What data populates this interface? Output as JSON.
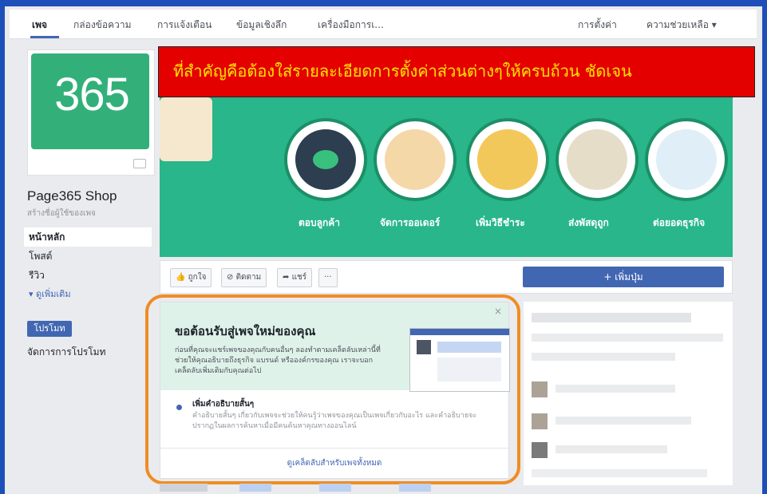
{
  "nav": {
    "items": [
      "เพจ",
      "กล่องข้อความ",
      "การแจ้งเตือน",
      "ข้อมูลเชิงลึก",
      "เครื่องมือการเ...",
      "การตั้งค่า",
      "ความช่วยเหลือ ▾"
    ]
  },
  "profile": {
    "logo_text": "365",
    "page_name": "Page365 Shop",
    "username_prompt": "สร้างชื่อผู้ใช้ของเพจ"
  },
  "sidebar": {
    "items": [
      "หน้าหลัก",
      "โพสต์",
      "รีวิว",
      "▾ ดูเพิ่มเติม"
    ],
    "promote_label": "โปรโมท",
    "manage_promotions": "จัดการการโปรโมท"
  },
  "banner": {
    "text": "ที่สำคัญคือต้องใส่รายละเอียดการตั้งค่าส่วนต่างๆให้ครบถ้วน ชัดเจน"
  },
  "cover": {
    "labels": [
      "ตอบลูกค้า",
      "จัดการออเดอร์",
      "เพิ่มวิธีชำระ",
      "ส่งพัสดุถูก",
      "ต่อยอดธุรกิจ"
    ]
  },
  "actions": {
    "like": "👍 ถูกใจ",
    "follow": "ติดตาม",
    "share": "แชร์",
    "more": "···",
    "add_button": "+ เพิ่มปุ่ม"
  },
  "welcome": {
    "title": "ขอต้อนรับสู่เพจใหม่ของคุณ",
    "description": "ก่อนที่คุณจะแชร์เพจของคุณกับคนอื่นๆ ลองทำตามเคล็ดลับเหล่านี้ที่ช่วยให้คุณอธิบายถึงธุรกิจ แบรนด์ หรือองค์กรของคุณ เราจะบอกเคล็ดลับเพิ่มเติมกับคุณต่อไป",
    "close": "×",
    "tip_title": "เพิ่มคำอธิบายสั้นๆ",
    "tip_description": "คำอธิบายสั้นๆ เกี่ยวกับเพจจะช่วยให้คนรู้ว่าเพจของคุณเป็นเพจเกี่ยวกับอะไร และคำอธิบายจะปรากฏในผลการค้นหาเมื่อมีคนค้นหาคุณทางออนไลน์",
    "see_all": "ดูเคล็ดลับสำหรับเพจทั้งหมด"
  },
  "colors": {
    "facebook_blue": "#4267b2",
    "cover_green": "#28b68a",
    "banner_red": "#e50000",
    "banner_text": "#ffe600",
    "highlight_orange": "#f08c24"
  }
}
